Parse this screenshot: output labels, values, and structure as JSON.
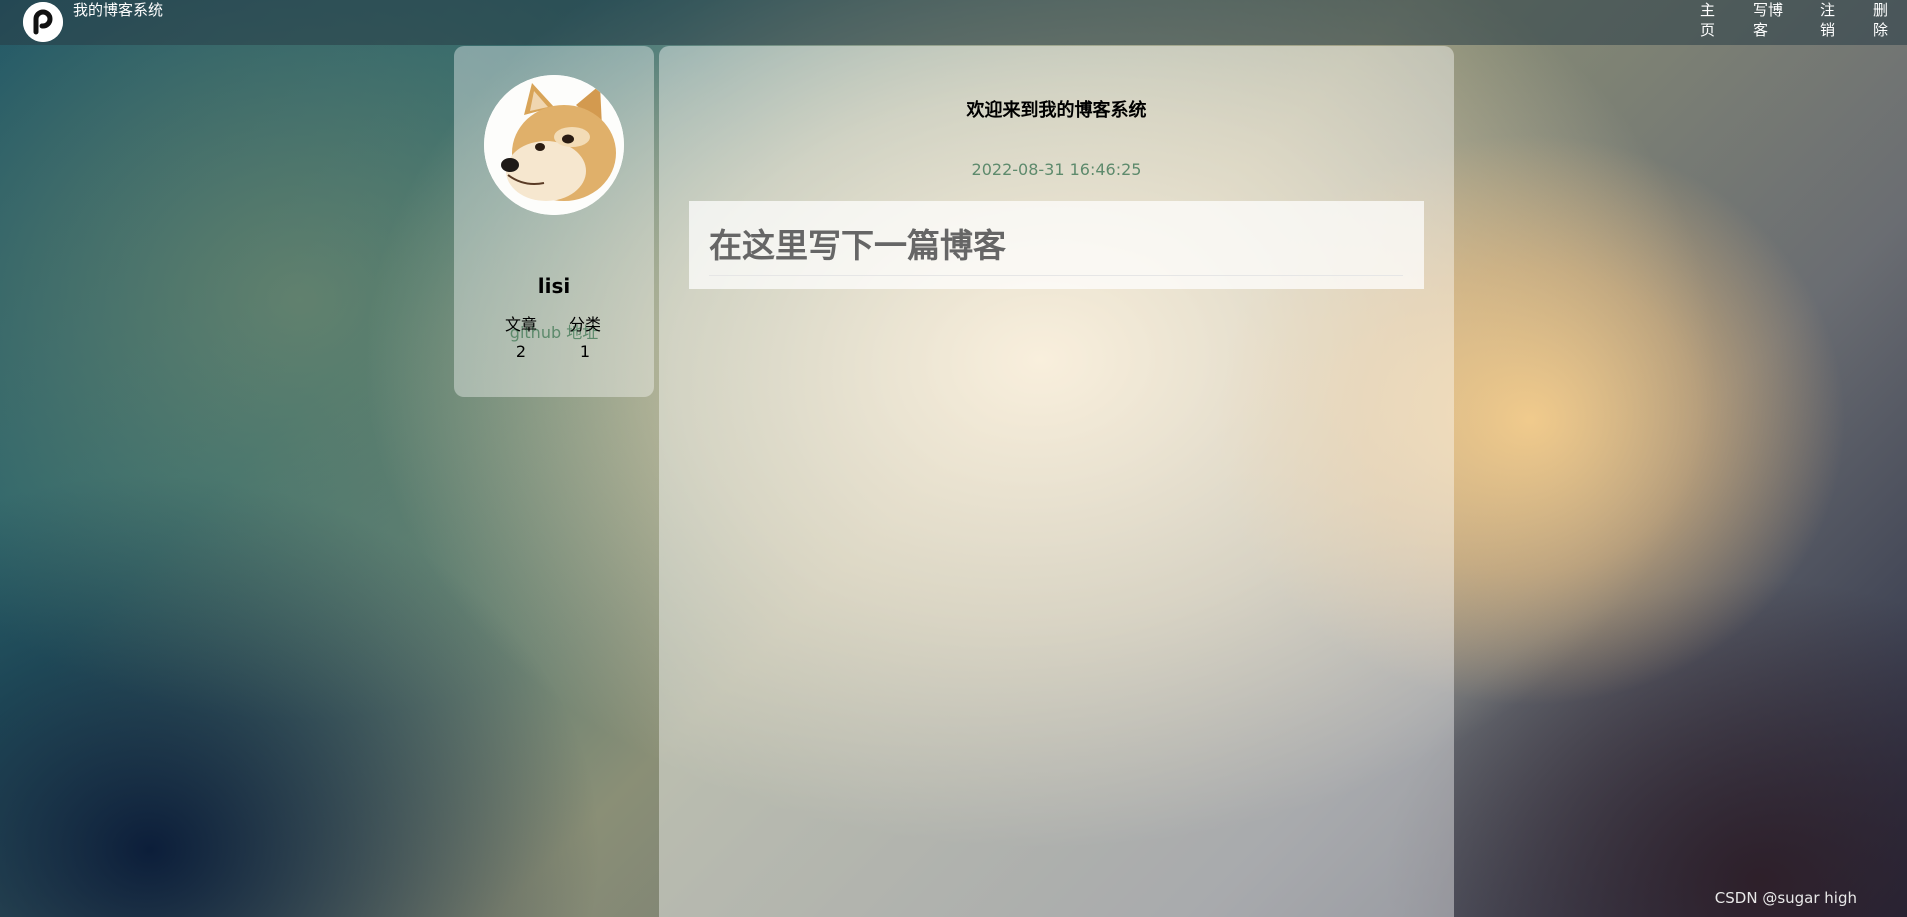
{
  "header": {
    "site_title": "我的博客系统",
    "links": {
      "home": "主页",
      "write": "写博客",
      "logout": "注销",
      "delete": "删除"
    }
  },
  "profile": {
    "username": "lisi",
    "github_label": "github 地址",
    "stats": {
      "articles_label": "文章",
      "categories_label": "分类",
      "articles_count": "2",
      "categories_count": "1"
    }
  },
  "blog": {
    "title": "欢迎来到我的博客系统",
    "date": "2022-08-31 16:46:25",
    "content_heading": "在这里写下一篇博客"
  },
  "watermark": "CSDN @sugar high"
}
